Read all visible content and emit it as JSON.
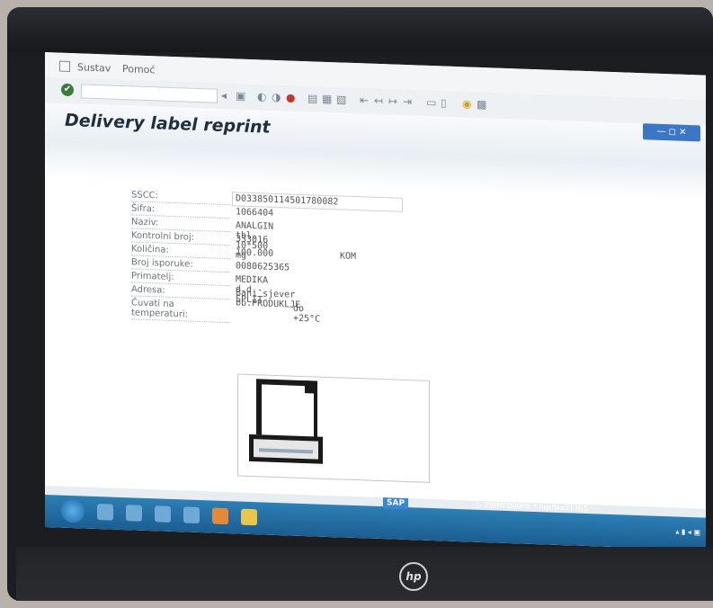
{
  "menu": {
    "items": [
      "Sustav",
      "Pomoć"
    ]
  },
  "toolbar": {
    "icons": [
      "back-icon",
      "save-icon",
      "print-icon",
      "find-icon",
      "layout-icon",
      "settings-icon",
      "help-icon"
    ]
  },
  "title": "Delivery label reprint",
  "window_controls": "— ◻ ✕",
  "form": {
    "rows": [
      {
        "label": "SSCC:",
        "value": "D033850114501780082",
        "value2": ""
      },
      {
        "label": "Šifra:",
        "value": "1066404",
        "value2": ""
      },
      {
        "label": "Naziv:",
        "value": "ANALGIN tbl. 10*500 mg",
        "value2": ""
      },
      {
        "label": "Kontrolni broj:",
        "value": "333016",
        "value2": ""
      },
      {
        "label": "Količina:",
        "value": "100.000",
        "value2": "KOM"
      },
      {
        "label": "Broj isporuke:",
        "value": "0080625365",
        "value2": ""
      },
      {
        "label": "Primatelj:",
        "value": "MEDIKA d.d.-SPLIT",
        "value2": ""
      },
      {
        "label": "Adresa:",
        "value": "Bani sjever bb.PRODUKLJE",
        "value2": ""
      },
      {
        "label": "Čuvati na temperaturi:",
        "value": "do +25°C",
        "value2": ""
      }
    ]
  },
  "statusbar": {
    "sap_label": "SAP",
    "text": "▷  ZWMFD00PR * hqsfwa21  INS"
  },
  "colors": {
    "taskbar": "#2d7fb5",
    "title": "#1f2f3f",
    "window_controls": "#3c77c6"
  }
}
